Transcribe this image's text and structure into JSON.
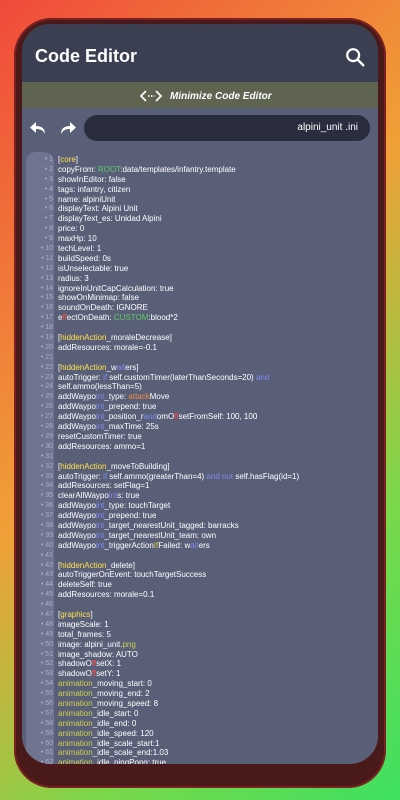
{
  "app": {
    "title": "Code Editor",
    "minimize_label": "Minimize Code Editor",
    "filename": "alpini_unit .ini"
  },
  "colors": {
    "appbar": "#3b3f52",
    "editor_bg": "#5a5f78",
    "section": "#ffe14a",
    "keyword": "#5ec86a",
    "attr": "#7c8cf0",
    "value": "#f08a3a"
  },
  "icons": {
    "search": "search-icon",
    "minimize": "collapse-arrows-icon",
    "undo": "undo-icon",
    "redo": "redo-icon"
  },
  "lines": [
    {
      "n": "1",
      "segs": [
        {
          "t": "[",
          "c": ""
        },
        {
          "t": "core",
          "c": "sec"
        },
        {
          "t": "]",
          "c": ""
        }
      ]
    },
    {
      "n": "2",
      "segs": [
        {
          "t": "copyFrom: ",
          "c": ""
        },
        {
          "t": "ROOT",
          "c": "k1"
        },
        {
          "t": ":data/templates/infantry.template",
          "c": ""
        }
      ]
    },
    {
      "n": "3",
      "segs": [
        {
          "t": "showInEditor: false",
          "c": ""
        }
      ]
    },
    {
      "n": "4",
      "segs": [
        {
          "t": "tags: infantry, citizen",
          "c": ""
        }
      ]
    },
    {
      "n": "5",
      "segs": [
        {
          "t": "name: alpiniUnit",
          "c": ""
        }
      ]
    },
    {
      "n": "6",
      "segs": [
        {
          "t": "displayText: Alpini Unit",
          "c": ""
        }
      ]
    },
    {
      "n": "7",
      "segs": [
        {
          "t": "displayText_es: Unidad Alpini",
          "c": ""
        }
      ]
    },
    {
      "n": "8",
      "segs": [
        {
          "t": "price: 0",
          "c": ""
        }
      ]
    },
    {
      "n": "9",
      "segs": [
        {
          "t": "maxHp: 10",
          "c": ""
        }
      ]
    },
    {
      "n": "10",
      "segs": [
        {
          "t": "techLevel: 1",
          "c": ""
        }
      ]
    },
    {
      "n": "11",
      "segs": [
        {
          "t": "buildSpeed: 0s",
          "c": ""
        }
      ]
    },
    {
      "n": "12",
      "segs": [
        {
          "t": "isUnselectable: true",
          "c": ""
        }
      ]
    },
    {
      "n": "13",
      "segs": [
        {
          "t": "radius: 3",
          "c": ""
        }
      ]
    },
    {
      "n": "14",
      "segs": [
        {
          "t": "ignoreInUnitCapCalculation: true",
          "c": ""
        }
      ]
    },
    {
      "n": "15",
      "segs": [
        {
          "t": "showOnMinimap: false",
          "c": ""
        }
      ]
    },
    {
      "n": "16",
      "segs": [
        {
          "t": "soundOnDeath: IGNORE",
          "c": ""
        }
      ]
    },
    {
      "n": "17",
      "segs": [
        {
          "t": "e",
          "c": ""
        },
        {
          "t": "ff",
          "c": "k4"
        },
        {
          "t": "ectOnDeath: ",
          "c": ""
        },
        {
          "t": "CUSTOM",
          "c": "k1"
        },
        {
          "t": ":blood*2",
          "c": ""
        }
      ]
    },
    {
      "n": "18",
      "segs": []
    },
    {
      "n": "19",
      "segs": [
        {
          "t": "[",
          "c": ""
        },
        {
          "t": "hiddenAction",
          "c": "sec"
        },
        {
          "t": "_moraleDecrease]",
          "c": ""
        }
      ]
    },
    {
      "n": "20",
      "segs": [
        {
          "t": "addResources: morale=-0.1",
          "c": ""
        }
      ]
    },
    {
      "n": "21",
      "segs": []
    },
    {
      "n": "22",
      "segs": [
        {
          "t": "[",
          "c": ""
        },
        {
          "t": "hiddenAction",
          "c": "sec"
        },
        {
          "t": "_w",
          "c": ""
        },
        {
          "t": "ait",
          "c": "k2"
        },
        {
          "t": "ers]",
          "c": ""
        }
      ]
    },
    {
      "n": "23",
      "segs": [
        {
          "t": "autoTrigger: ",
          "c": ""
        },
        {
          "t": "if",
          "c": "k2"
        },
        {
          "t": " self.customTimer(laterThanSeconds=20) ",
          "c": ""
        },
        {
          "t": "and",
          "c": "k2"
        }
      ]
    },
    {
      "n": "24",
      "segs": [
        {
          "t": "self.ammo(lessThan=5)",
          "c": ""
        }
      ]
    },
    {
      "n": "25",
      "segs": [
        {
          "t": "addWaypo",
          "c": ""
        },
        {
          "t": "int",
          "c": "k2"
        },
        {
          "t": "_type: ",
          "c": ""
        },
        {
          "t": "attack",
          "c": "k3"
        },
        {
          "t": "Move",
          "c": ""
        }
      ]
    },
    {
      "n": "26",
      "segs": [
        {
          "t": "addWaypo",
          "c": ""
        },
        {
          "t": "int",
          "c": "k2"
        },
        {
          "t": "_prepend: true",
          "c": ""
        }
      ]
    },
    {
      "n": "27",
      "segs": [
        {
          "t": "addWaypo",
          "c": ""
        },
        {
          "t": "int",
          "c": "k2"
        },
        {
          "t": "_position_r",
          "c": ""
        },
        {
          "t": "and",
          "c": "k2"
        },
        {
          "t": "omO",
          "c": ""
        },
        {
          "t": "ff",
          "c": "k4"
        },
        {
          "t": "setFromSelf: 100, 100",
          "c": ""
        }
      ]
    },
    {
      "n": "28",
      "segs": [
        {
          "t": "addWaypo",
          "c": ""
        },
        {
          "t": "int",
          "c": "k2"
        },
        {
          "t": "_maxTime: 25s",
          "c": ""
        }
      ]
    },
    {
      "n": "29",
      "segs": [
        {
          "t": "resetCustomTimer: true",
          "c": ""
        }
      ]
    },
    {
      "n": "30",
      "segs": [
        {
          "t": "addResources: ammo=1",
          "c": ""
        }
      ]
    },
    {
      "n": "31",
      "segs": []
    },
    {
      "n": "32",
      "segs": [
        {
          "t": "[",
          "c": ""
        },
        {
          "t": "hiddenAction",
          "c": "sec"
        },
        {
          "t": "_moveToBuilding]",
          "c": ""
        }
      ]
    },
    {
      "n": "33",
      "segs": [
        {
          "t": "autoTrigger: ",
          "c": ""
        },
        {
          "t": "if",
          "c": "k2"
        },
        {
          "t": " self.ammo(greaterThan=4) ",
          "c": ""
        },
        {
          "t": "and not",
          "c": "k2"
        },
        {
          "t": " self.hasFlag(id=1)",
          "c": ""
        }
      ]
    },
    {
      "n": "34",
      "segs": [
        {
          "t": "addResources: setFlag=1",
          "c": ""
        }
      ]
    },
    {
      "n": "35",
      "segs": [
        {
          "t": "clearAllWaypo",
          "c": ""
        },
        {
          "t": "int",
          "c": "k2"
        },
        {
          "t": "s: true",
          "c": ""
        }
      ]
    },
    {
      "n": "36",
      "segs": [
        {
          "t": "addWaypo",
          "c": ""
        },
        {
          "t": "int",
          "c": "k2"
        },
        {
          "t": "_type: touchTarget",
          "c": ""
        }
      ]
    },
    {
      "n": "37",
      "segs": [
        {
          "t": "addWaypo",
          "c": ""
        },
        {
          "t": "int",
          "c": "k2"
        },
        {
          "t": "_prepend: true",
          "c": ""
        }
      ]
    },
    {
      "n": "38",
      "segs": [
        {
          "t": "addWaypo",
          "c": ""
        },
        {
          "t": "int",
          "c": "k2"
        },
        {
          "t": "_target_nearestUnit_tagged: barracks",
          "c": ""
        }
      ]
    },
    {
      "n": "39",
      "segs": [
        {
          "t": "addWaypo",
          "c": ""
        },
        {
          "t": "int",
          "c": "k2"
        },
        {
          "t": "_target_nearestUnit_team: own",
          "c": ""
        }
      ]
    },
    {
      "n": "40",
      "segs": [
        {
          "t": "addWaypo",
          "c": ""
        },
        {
          "t": "int",
          "c": "k2"
        },
        {
          "t": "_triggerAction",
          "c": ""
        },
        {
          "t": "If",
          "c": "k5"
        },
        {
          "t": "Failed: w",
          "c": ""
        },
        {
          "t": "ait",
          "c": "k2"
        },
        {
          "t": "ers",
          "c": ""
        }
      ]
    },
    {
      "n": "41",
      "segs": []
    },
    {
      "n": "42",
      "segs": [
        {
          "t": "[",
          "c": ""
        },
        {
          "t": "hiddenAction",
          "c": "sec"
        },
        {
          "t": "_delete]",
          "c": ""
        }
      ]
    },
    {
      "n": "43",
      "segs": [
        {
          "t": "autoTriggerOnEvent: touchTargetSuccess",
          "c": ""
        }
      ]
    },
    {
      "n": "44",
      "segs": [
        {
          "t": "deleteSelf: true",
          "c": ""
        }
      ]
    },
    {
      "n": "45",
      "segs": [
        {
          "t": "addResources: morale=0.1",
          "c": ""
        }
      ]
    },
    {
      "n": "46",
      "segs": []
    },
    {
      "n": "47",
      "segs": [
        {
          "t": "[",
          "c": ""
        },
        {
          "t": "graphics",
          "c": "sec"
        },
        {
          "t": "]",
          "c": ""
        }
      ]
    },
    {
      "n": "48",
      "segs": [
        {
          "t": "imageScale: 1",
          "c": ""
        }
      ]
    },
    {
      "n": "49",
      "segs": [
        {
          "t": "total_frames: 5",
          "c": ""
        }
      ]
    },
    {
      "n": "50",
      "segs": [
        {
          "t": "image:     alpini_unit.",
          "c": ""
        },
        {
          "t": "png",
          "c": "k5"
        }
      ]
    },
    {
      "n": "51",
      "segs": [
        {
          "t": "image_shadow: AUTO",
          "c": ""
        }
      ]
    },
    {
      "n": "52",
      "segs": [
        {
          "t": "shadowO",
          "c": ""
        },
        {
          "t": "ff",
          "c": "k4"
        },
        {
          "t": "setX: 1",
          "c": ""
        }
      ]
    },
    {
      "n": "53",
      "segs": [
        {
          "t": "shadowO",
          "c": ""
        },
        {
          "t": "ff",
          "c": "k4"
        },
        {
          "t": "setY: 1",
          "c": ""
        }
      ]
    },
    {
      "n": "54",
      "segs": [
        {
          "t": "animation",
          "c": "k5"
        },
        {
          "t": "_moving_start: 0",
          "c": ""
        }
      ]
    },
    {
      "n": "55",
      "segs": [
        {
          "t": "animation",
          "c": "k5"
        },
        {
          "t": "_moving_end: 2",
          "c": ""
        }
      ]
    },
    {
      "n": "56",
      "segs": [
        {
          "t": "animation",
          "c": "k5"
        },
        {
          "t": "_moving_speed: 8",
          "c": ""
        }
      ]
    },
    {
      "n": "57",
      "segs": [
        {
          "t": "animation",
          "c": "k5"
        },
        {
          "t": "_idle_start: 0",
          "c": ""
        }
      ]
    },
    {
      "n": "58",
      "segs": [
        {
          "t": "animation",
          "c": "k5"
        },
        {
          "t": "_idle_end: 0",
          "c": ""
        }
      ]
    },
    {
      "n": "59",
      "segs": [
        {
          "t": "animation",
          "c": "k5"
        },
        {
          "t": "_idle_speed: 120",
          "c": ""
        }
      ]
    },
    {
      "n": "60",
      "segs": [
        {
          "t": "animation",
          "c": "k5"
        },
        {
          "t": "_idle_scale_start:1",
          "c": ""
        }
      ]
    },
    {
      "n": "61",
      "segs": [
        {
          "t": "animation",
          "c": "k5"
        },
        {
          "t": "_idle_scale_end:1.03",
          "c": ""
        }
      ]
    },
    {
      "n": "62",
      "segs": [
        {
          "t": "animation",
          "c": "k5"
        },
        {
          "t": "_idle_pingPong: true",
          "c": ""
        }
      ]
    }
  ]
}
